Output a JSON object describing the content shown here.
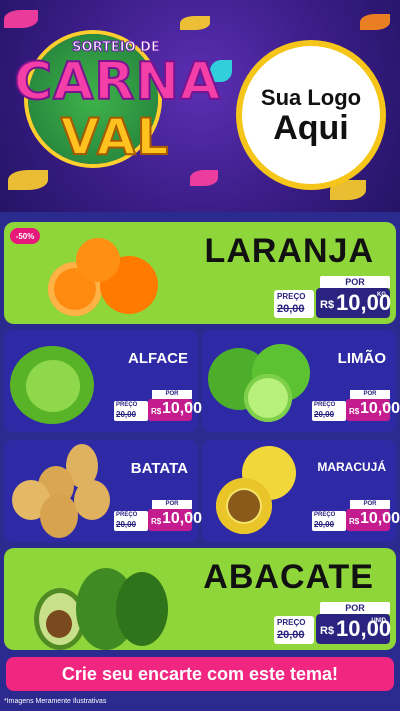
{
  "header": {
    "title_small": "SORTEIO DE",
    "title_big_1": "CARNA",
    "title_big_2": "VAL",
    "logo_line1": "Sua Logo",
    "logo_line2": "Aqui"
  },
  "colors": {
    "green_card": "#8ed63a",
    "blue_card": "#2e2aa6",
    "pink": "#f02680",
    "yellow": "#f5c519"
  },
  "products": {
    "laranja": {
      "discount": "-50%",
      "name": "LARANJA",
      "por": "POR",
      "preco": "PREÇO",
      "old_price": "20,00",
      "currency": "R$",
      "price": "10,00",
      "unit": "KG"
    },
    "alface": {
      "name": "ALFACE",
      "por": "POR",
      "preco": "PREÇO",
      "old_price": "20,00",
      "currency": "R$",
      "price": "10,00",
      "unit": "KG"
    },
    "limao": {
      "name": "LIMÃO",
      "por": "POR",
      "preco": "PREÇO",
      "old_price": "20,00",
      "currency": "R$",
      "price": "10,00",
      "unit": "KG"
    },
    "batata": {
      "name": "BATATA",
      "por": "POR",
      "preco": "PREÇO",
      "old_price": "20,00",
      "currency": "R$",
      "price": "10,00",
      "unit": "KG"
    },
    "maracuja": {
      "name": "MARACUJÁ",
      "por": "POR",
      "preco": "PREÇO",
      "old_price": "20,00",
      "currency": "R$",
      "price": "10,00",
      "unit": "KG"
    },
    "abacate": {
      "name": "ABACATE",
      "por": "POR",
      "preco": "PREÇO",
      "old_price": "20,00",
      "currency": "R$",
      "price": "10,00",
      "unit": "UNID"
    }
  },
  "banner": "Crie seu encarte com este tema!",
  "footer": "*Imagens Meramente Ilustrativas"
}
